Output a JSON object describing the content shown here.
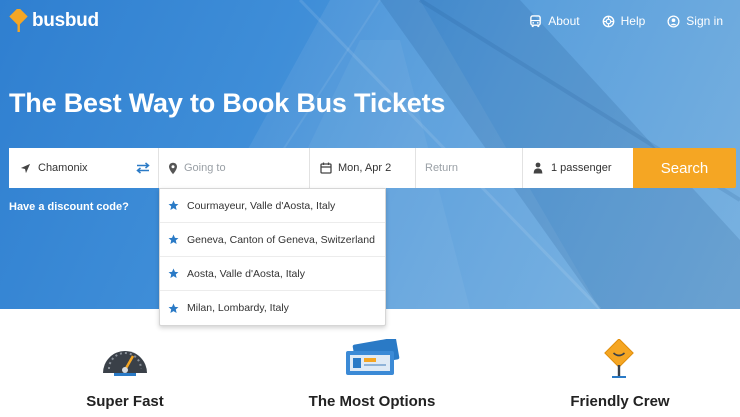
{
  "brand": {
    "name": "busbud"
  },
  "nav": {
    "about": "About",
    "help": "Help",
    "signin": "Sign in"
  },
  "hero": {
    "headline": "The Best Way to Book Bus Tickets"
  },
  "search": {
    "origin": "Chamonix",
    "destination_placeholder": "Going to",
    "date": "Mon, Apr 2",
    "return_placeholder": "Return",
    "passengers": "1 passenger",
    "button": "Search"
  },
  "discount": "Have a discount code?",
  "suggestions": [
    "Courmayeur, Valle d'Aosta, Italy",
    "Geneva, Canton of Geneva, Switzerland",
    "Aosta, Valle d'Aosta, Italy",
    "Milan, Lombardy, Italy"
  ],
  "features": [
    {
      "label": "Super Fast",
      "icon": "speedometer-icon"
    },
    {
      "label": "The Most Options",
      "icon": "tickets-icon"
    },
    {
      "label": "Friendly Crew",
      "icon": "road-sign-icon"
    }
  ],
  "colors": {
    "accent": "#f5a623",
    "link": "#2a7ac6",
    "hero": "#3f8ed8"
  }
}
